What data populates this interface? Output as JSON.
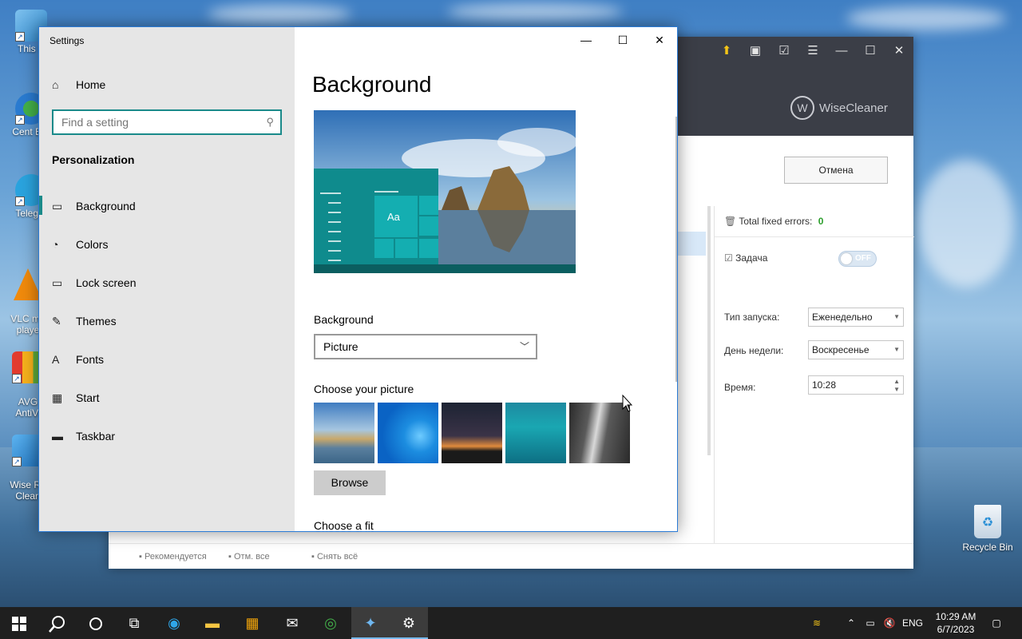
{
  "desktop": {
    "icons": [
      {
        "label": "This P"
      },
      {
        "label": "Cent Bro"
      },
      {
        "label": "Telegra"
      },
      {
        "label": "VLC me\nplaye"
      },
      {
        "label": "AVG\nAntiVi"
      },
      {
        "label": "Wise Re\nClean"
      }
    ],
    "recycle_bin": "Recycle Bin"
  },
  "wise": {
    "logo": "WiseCleaner",
    "logo_mark": "W",
    "cancel_label": "Отмена",
    "fixed_errors_label": "Total fixed errors:",
    "fixed_errors_value": "0",
    "task_label": "Задача",
    "toggle_label": "OFF",
    "launch_type_label": "Тип запуска:",
    "launch_type_value": "Еженедельно",
    "weekday_label": "День недели:",
    "weekday_value": "Воскресенье",
    "time_label": "Время:",
    "time_value": "10:28",
    "bottom_links": [
      "Рекомендуется",
      "Отм. все",
      "Снять всё"
    ]
  },
  "settings": {
    "window_title": "Settings",
    "home_label": "Home",
    "search_placeholder": "Find a setting",
    "section_heading": "Personalization",
    "nav": [
      {
        "label": "Background",
        "icon": "picture-icon",
        "glyph": "▭"
      },
      {
        "label": "Colors",
        "icon": "palette-icon",
        "glyph": "◔"
      },
      {
        "label": "Lock screen",
        "icon": "lock-screen-icon",
        "glyph": "▭"
      },
      {
        "label": "Themes",
        "icon": "brush-icon",
        "glyph": "✎"
      },
      {
        "label": "Fonts",
        "icon": "fonts-icon",
        "glyph": "A"
      },
      {
        "label": "Start",
        "icon": "start-icon",
        "glyph": "▦"
      },
      {
        "label": "Taskbar",
        "icon": "taskbar-icon",
        "glyph": "▬"
      }
    ],
    "page_title": "Background",
    "preview_sample_text": "Aa",
    "background_label": "Background",
    "background_value": "Picture",
    "choose_picture_label": "Choose your picture",
    "browse_label": "Browse",
    "choose_fit_label": "Choose a fit"
  },
  "taskbar": {
    "language": "ENG",
    "time": "10:29 AM",
    "date": "6/7/2023"
  },
  "colors": {
    "accent": "#1a8a8a",
    "wise_header": "#3b3e47",
    "taskbar": "#1f1f1f"
  }
}
